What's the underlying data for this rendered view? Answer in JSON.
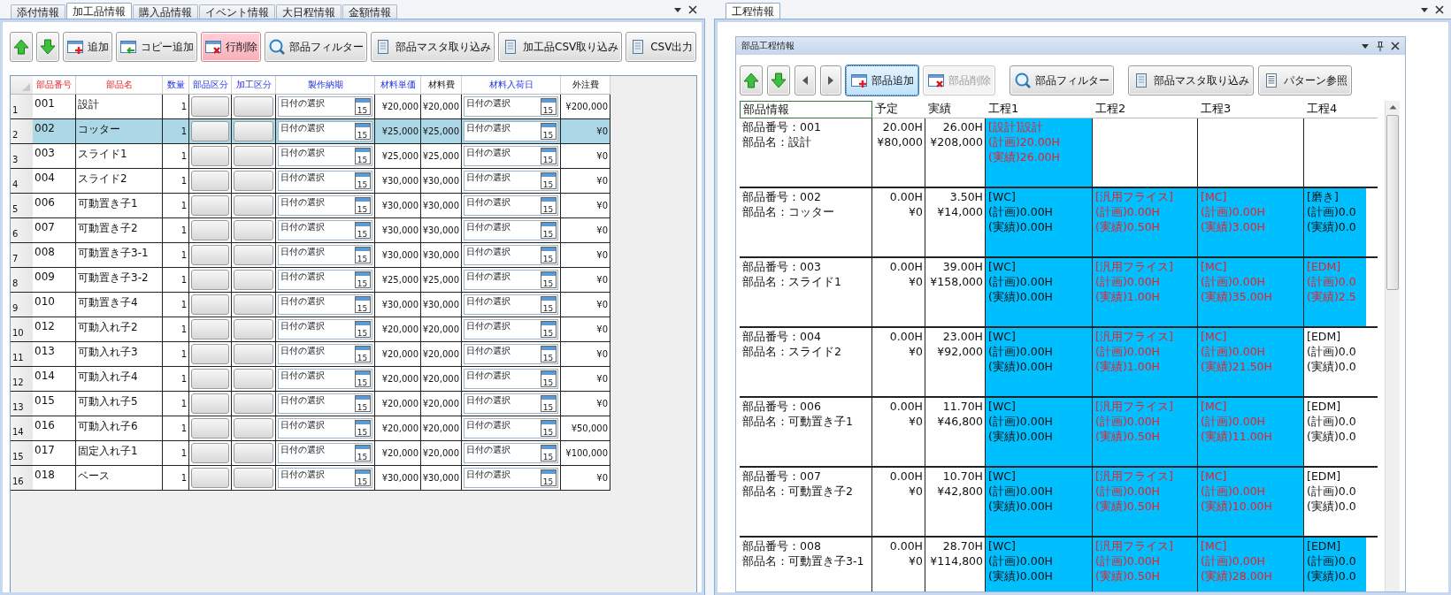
{
  "left": {
    "tabs": [
      {
        "label": "添付情報",
        "selected": false
      },
      {
        "label": "加工品情報",
        "selected": true
      },
      {
        "label": "購入品情報",
        "selected": false
      },
      {
        "label": "イベント情報",
        "selected": false
      },
      {
        "label": "大日程情報",
        "selected": false
      },
      {
        "label": "金額情報",
        "selected": false
      }
    ],
    "toolbar": [
      {
        "kind": "up",
        "hovered": false,
        "focused": false,
        "disabled": false
      },
      {
        "kind": "down",
        "hovered": false,
        "focused": false,
        "disabled": false
      },
      {
        "kind": "add",
        "label": "追加",
        "hovered": false,
        "focused": false,
        "disabled": false
      },
      {
        "kind": "copy",
        "label": "コピー追加",
        "hovered": false,
        "focused": false,
        "disabled": false
      },
      {
        "kind": "delete",
        "label": "行削除",
        "hovered": true,
        "focused": false,
        "disabled": false
      },
      {
        "kind": "filter",
        "label": "部品フィルター",
        "hovered": false,
        "focused": false,
        "disabled": false
      },
      {
        "kind": "import",
        "label": "部品マスタ取り込み",
        "hovered": false,
        "focused": false,
        "disabled": false
      },
      {
        "kind": "import",
        "label": "加工品CSV取り込み",
        "hovered": false,
        "focused": false,
        "disabled": false
      },
      {
        "kind": "import",
        "label": "CSV出力",
        "hovered": false,
        "focused": false,
        "disabled": false
      }
    ],
    "columns": [
      {
        "label": "部品番号",
        "kind": "key"
      },
      {
        "label": "部品名",
        "kind": "key"
      },
      {
        "label": "数量",
        "kind": "input"
      },
      {
        "label": "部品区分",
        "kind": "input"
      },
      {
        "label": "加工区分",
        "kind": "input"
      },
      {
        "label": "製作納期",
        "kind": "input"
      },
      {
        "label": "材料単価",
        "kind": "input"
      },
      {
        "label": "材料費",
        "kind": "computed"
      },
      {
        "label": "材料入荷日",
        "kind": "input"
      },
      {
        "label": "外注費",
        "kind": "computed"
      }
    ],
    "rows": [
      {
        "no": "1",
        "code": "001",
        "name": "設計",
        "qty": "1",
        "delivery": {
          "placeholder": "日付の選択",
          "calendar": "15"
        },
        "unit_price": "¥20,000",
        "material_cost": "¥20,000",
        "arrival": {
          "placeholder": "日付の選択",
          "calendar": "15"
        },
        "outsourcing": "¥200,000",
        "selected": false
      },
      {
        "no": "2",
        "code": "002",
        "name": "コッター",
        "qty": "1",
        "delivery": {
          "placeholder": "日付の選択",
          "calendar": "15"
        },
        "unit_price": "¥25,000",
        "material_cost": "¥25,000",
        "arrival": {
          "placeholder": "日付の選択",
          "calendar": "15"
        },
        "outsourcing": "¥0",
        "selected": true
      },
      {
        "no": "3",
        "code": "003",
        "name": "スライド1",
        "qty": "1",
        "delivery": {
          "placeholder": "日付の選択",
          "calendar": "15"
        },
        "unit_price": "¥25,000",
        "material_cost": "¥25,000",
        "arrival": {
          "placeholder": "日付の選択",
          "calendar": "15"
        },
        "outsourcing": "¥0",
        "selected": false
      },
      {
        "no": "4",
        "code": "004",
        "name": "スライド2",
        "qty": "1",
        "delivery": {
          "placeholder": "日付の選択",
          "calendar": "15"
        },
        "unit_price": "¥30,000",
        "material_cost": "¥30,000",
        "arrival": {
          "placeholder": "日付の選択",
          "calendar": "15"
        },
        "outsourcing": "¥0",
        "selected": false
      },
      {
        "no": "5",
        "code": "006",
        "name": "可動置き子1",
        "qty": "1",
        "delivery": {
          "placeholder": "日付の選択",
          "calendar": "15"
        },
        "unit_price": "¥30,000",
        "material_cost": "¥30,000",
        "arrival": {
          "placeholder": "日付の選択",
          "calendar": "15"
        },
        "outsourcing": "¥0",
        "selected": false
      },
      {
        "no": "6",
        "code": "007",
        "name": "可動置き子2",
        "qty": "1",
        "delivery": {
          "placeholder": "日付の選択",
          "calendar": "15"
        },
        "unit_price": "¥30,000",
        "material_cost": "¥30,000",
        "arrival": {
          "placeholder": "日付の選択",
          "calendar": "15"
        },
        "outsourcing": "¥0",
        "selected": false
      },
      {
        "no": "7",
        "code": "008",
        "name": "可動置き子3-1",
        "qty": "1",
        "delivery": {
          "placeholder": "日付の選択",
          "calendar": "15"
        },
        "unit_price": "¥30,000",
        "material_cost": "¥30,000",
        "arrival": {
          "placeholder": "日付の選択",
          "calendar": "15"
        },
        "outsourcing": "¥0",
        "selected": false
      },
      {
        "no": "8",
        "code": "009",
        "name": "可動置き子3-2",
        "qty": "1",
        "delivery": {
          "placeholder": "日付の選択",
          "calendar": "15"
        },
        "unit_price": "¥25,000",
        "material_cost": "¥25,000",
        "arrival": {
          "placeholder": "日付の選択",
          "calendar": "15"
        },
        "outsourcing": "¥0",
        "selected": false
      },
      {
        "no": "9",
        "code": "010",
        "name": "可動置き子4",
        "qty": "1",
        "delivery": {
          "placeholder": "日付の選択",
          "calendar": "15"
        },
        "unit_price": "¥30,000",
        "material_cost": "¥30,000",
        "arrival": {
          "placeholder": "日付の選択",
          "calendar": "15"
        },
        "outsourcing": "¥0",
        "selected": false
      },
      {
        "no": "10",
        "code": "012",
        "name": "可動入れ子2",
        "qty": "1",
        "delivery": {
          "placeholder": "日付の選択",
          "calendar": "15"
        },
        "unit_price": "¥20,000",
        "material_cost": "¥20,000",
        "arrival": {
          "placeholder": "日付の選択",
          "calendar": "15"
        },
        "outsourcing": "¥0",
        "selected": false
      },
      {
        "no": "11",
        "code": "013",
        "name": "可動入れ子3",
        "qty": "1",
        "delivery": {
          "placeholder": "日付の選択",
          "calendar": "15"
        },
        "unit_price": "¥20,000",
        "material_cost": "¥20,000",
        "arrival": {
          "placeholder": "日付の選択",
          "calendar": "15"
        },
        "outsourcing": "¥0",
        "selected": false
      },
      {
        "no": "12",
        "code": "014",
        "name": "可動入れ子4",
        "qty": "1",
        "delivery": {
          "placeholder": "日付の選択",
          "calendar": "15"
        },
        "unit_price": "¥20,000",
        "material_cost": "¥20,000",
        "arrival": {
          "placeholder": "日付の選択",
          "calendar": "15"
        },
        "outsourcing": "¥0",
        "selected": false
      },
      {
        "no": "13",
        "code": "015",
        "name": "可動入れ子5",
        "qty": "1",
        "delivery": {
          "placeholder": "日付の選択",
          "calendar": "15"
        },
        "unit_price": "¥20,000",
        "material_cost": "¥20,000",
        "arrival": {
          "placeholder": "日付の選択",
          "calendar": "15"
        },
        "outsourcing": "¥0",
        "selected": false
      },
      {
        "no": "14",
        "code": "016",
        "name": "可動入れ子6",
        "qty": "1",
        "delivery": {
          "placeholder": "日付の選択",
          "calendar": "15"
        },
        "unit_price": "¥20,000",
        "material_cost": "¥20,000",
        "arrival": {
          "placeholder": "日付の選択",
          "calendar": "15"
        },
        "outsourcing": "¥50,000",
        "selected": false
      },
      {
        "no": "15",
        "code": "017",
        "name": "固定入れ子1",
        "qty": "1",
        "delivery": {
          "placeholder": "日付の選択",
          "calendar": "15"
        },
        "unit_price": "¥20,000",
        "material_cost": "¥20,000",
        "arrival": {
          "placeholder": "日付の選択",
          "calendar": "15"
        },
        "outsourcing": "¥100,000",
        "selected": false
      },
      {
        "no": "16",
        "code": "018",
        "name": "ベース",
        "qty": "1",
        "delivery": {
          "placeholder": "日付の選択",
          "calendar": "15"
        },
        "unit_price": "¥30,000",
        "material_cost": "¥30,000",
        "arrival": {
          "placeholder": "日付の選択",
          "calendar": "15"
        },
        "outsourcing": "¥0",
        "selected": false
      }
    ]
  },
  "right": {
    "tabs": [
      {
        "label": "工程情報",
        "selected": true
      }
    ],
    "panel": {
      "title": "部品工程情報",
      "toolbar": [
        {
          "kind": "up",
          "hovered": false,
          "focused": false,
          "disabled": false
        },
        {
          "kind": "down",
          "hovered": false,
          "focused": false,
          "disabled": false
        },
        {
          "kind": "previous",
          "hovered": false,
          "focused": false,
          "disabled": false
        },
        {
          "kind": "next",
          "hovered": false,
          "focused": false,
          "disabled": false
        },
        {
          "kind": "add",
          "label": "部品追加",
          "hovered": false,
          "focused": true,
          "disabled": false
        },
        {
          "kind": "delete",
          "label": "部品削除",
          "hovered": false,
          "focused": false,
          "disabled": true
        },
        {
          "kind": "filter",
          "label": "部品フィルター",
          "hovered": false,
          "focused": false,
          "disabled": false
        },
        {
          "kind": "import",
          "label": "部品マスタ取り込み",
          "hovered": false,
          "focused": false,
          "disabled": false
        },
        {
          "kind": "pattern",
          "label": "パターン参照",
          "hovered": false,
          "focused": false,
          "disabled": false
        }
      ],
      "columns": [
        "部品情報",
        "予定",
        "実績",
        "工程1",
        "工程2",
        "工程3",
        "工程4"
      ],
      "rows": [
        {
          "number": "部品番号：001",
          "name": "部品名：設計",
          "plan_hours": "20.00H",
          "plan_cost": "¥80,000",
          "actual_hours": "26.00H",
          "actual_cost": "¥208,000",
          "steps": [
            {
              "kind": "process",
              "title": "[設計]設計",
              "plan": "(計画)20.00H",
              "actual": "(実績)26.00H",
              "alert": true,
              "filled": true
            },
            {
              "kind": "empty"
            },
            {
              "kind": "empty"
            },
            {
              "kind": "empty"
            }
          ]
        },
        {
          "number": "部品番号：002",
          "name": "部品名：コッター",
          "plan_hours": "0.00H",
          "plan_cost": "¥0",
          "actual_hours": "3.50H",
          "actual_cost": "¥14,000",
          "steps": [
            {
              "kind": "process",
              "title": "[WC]",
              "plan": "(計画)0.00H",
              "actual": "(実績)0.00H",
              "alert": false,
              "filled": true
            },
            {
              "kind": "process",
              "title": "[汎用フライス]",
              "plan": "(計画)0.00H",
              "actual": "(実績)0.50H",
              "alert": true,
              "filled": true
            },
            {
              "kind": "process",
              "title": "[MC]",
              "plan": "(計画)0.00H",
              "actual": "(実績)3.00H",
              "alert": true,
              "filled": true
            },
            {
              "kind": "process",
              "title": "[磨き]",
              "plan": "(計画)0.0",
              "actual": "(実績)0.0",
              "alert": false,
              "filled": true
            }
          ]
        },
        {
          "number": "部品番号：003",
          "name": "部品名：スライド1",
          "plan_hours": "0.00H",
          "plan_cost": "¥0",
          "actual_hours": "39.00H",
          "actual_cost": "¥158,000",
          "steps": [
            {
              "kind": "process",
              "title": "[WC]",
              "plan": "(計画)0.00H",
              "actual": "(実績)0.00H",
              "alert": false,
              "filled": true
            },
            {
              "kind": "process",
              "title": "[汎用フライス]",
              "plan": "(計画)0.00H",
              "actual": "(実績)1.00H",
              "alert": true,
              "filled": true
            },
            {
              "kind": "process",
              "title": "[MC]",
              "plan": "(計画)0.00H",
              "actual": "(実績)35.00H",
              "alert": true,
              "filled": true
            },
            {
              "kind": "process",
              "title": "[EDM]",
              "plan": "(計画)0.0",
              "actual": "(実績)2.5",
              "alert": true,
              "filled": true
            }
          ]
        },
        {
          "number": "部品番号：004",
          "name": "部品名：スライド2",
          "plan_hours": "0.00H",
          "plan_cost": "¥0",
          "actual_hours": "23.00H",
          "actual_cost": "¥92,000",
          "steps": [
            {
              "kind": "process",
              "title": "[WC]",
              "plan": "(計画)0.00H",
              "actual": "(実績)0.00H",
              "alert": false,
              "filled": true
            },
            {
              "kind": "process",
              "title": "[汎用フライス]",
              "plan": "(計画)0.00H",
              "actual": "(実績)1.00H",
              "alert": true,
              "filled": true
            },
            {
              "kind": "process",
              "title": "[MC]",
              "plan": "(計画)0.00H",
              "actual": "(実績)21.50H",
              "alert": true,
              "filled": true
            },
            {
              "kind": "process",
              "title": "[EDM]",
              "plan": "(計画)0.0",
              "actual": "(実績)0.0",
              "alert": false,
              "filled": false
            }
          ]
        },
        {
          "number": "部品番号：006",
          "name": "部品名：可動置き子1",
          "plan_hours": "0.00H",
          "plan_cost": "¥0",
          "actual_hours": "11.70H",
          "actual_cost": "¥46,800",
          "steps": [
            {
              "kind": "process",
              "title": "[WC]",
              "plan": "(計画)0.00H",
              "actual": "(実績)0.00H",
              "alert": false,
              "filled": true
            },
            {
              "kind": "process",
              "title": "[汎用フライス]",
              "plan": "(計画)0.00H",
              "actual": "(実績)0.50H",
              "alert": true,
              "filled": true
            },
            {
              "kind": "process",
              "title": "[MC]",
              "plan": "(計画)0.00H",
              "actual": "(実績)11.00H",
              "alert": true,
              "filled": true
            },
            {
              "kind": "process",
              "title": "[EDM]",
              "plan": "(計画)0.0",
              "actual": "(実績)0.0",
              "alert": false,
              "filled": false
            }
          ]
        },
        {
          "number": "部品番号：007",
          "name": "部品名：可動置き子2",
          "plan_hours": "0.00H",
          "plan_cost": "¥0",
          "actual_hours": "10.70H",
          "actual_cost": "¥42,800",
          "steps": [
            {
              "kind": "process",
              "title": "[WC]",
              "plan": "(計画)0.00H",
              "actual": "(実績)0.00H",
              "alert": false,
              "filled": true
            },
            {
              "kind": "process",
              "title": "[汎用フライス]",
              "plan": "(計画)0.00H",
              "actual": "(実績)0.50H",
              "alert": true,
              "filled": true
            },
            {
              "kind": "process",
              "title": "[MC]",
              "plan": "(計画)0.00H",
              "actual": "(実績)10.00H",
              "alert": true,
              "filled": true
            },
            {
              "kind": "process",
              "title": "[EDM]",
              "plan": "(計画)0.0",
              "actual": "(実績)0.0",
              "alert": false,
              "filled": false
            }
          ]
        },
        {
          "number": "部品番号：008",
          "name": "部品名：可動置き子3-1",
          "plan_hours": "0.00H",
          "plan_cost": "¥0",
          "actual_hours": "28.70H",
          "actual_cost": "¥114,800",
          "steps": [
            {
              "kind": "process",
              "title": "[WC]",
              "plan": "(計画)0.00H",
              "actual": "(実績)0.00H",
              "alert": false,
              "filled": true
            },
            {
              "kind": "process",
              "title": "[汎用フライス]",
              "plan": "(計画)0.00H",
              "actual": "(実績)0.50H",
              "alert": true,
              "filled": true
            },
            {
              "kind": "process",
              "title": "[MC]",
              "plan": "(計画)0.00H",
              "actual": "(実績)28.00H",
              "alert": true,
              "filled": true
            },
            {
              "kind": "process",
              "title": "[EDM]",
              "plan": "(計画)0.0",
              "actual": "(実績)0.0",
              "alert": false,
              "filled": true
            }
          ]
        }
      ]
    }
  }
}
